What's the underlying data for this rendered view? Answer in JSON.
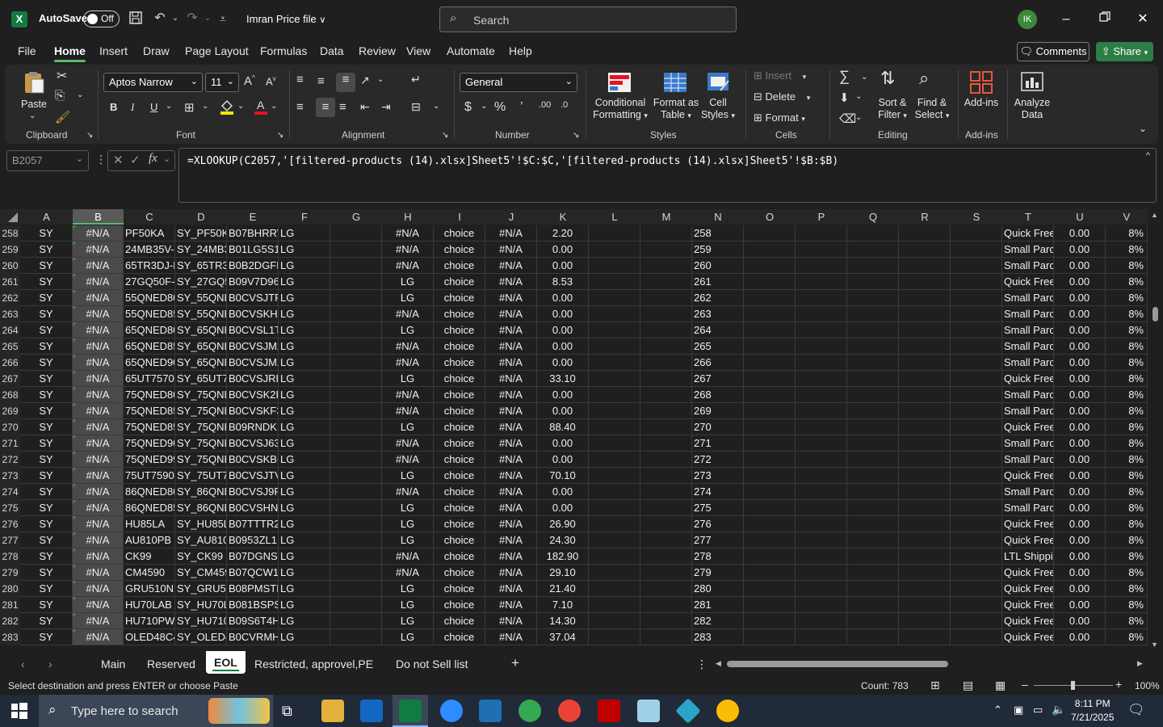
{
  "titlebar": {
    "app_logo": "X",
    "autosave_label": "AutoSave",
    "autosave_state": "Off",
    "file_title": "Imran Price file",
    "search_placeholder": "Search",
    "avatar_initials": "IK"
  },
  "menu": {
    "tabs": [
      "File",
      "Home",
      "Insert",
      "Draw",
      "Page Layout",
      "Formulas",
      "Data",
      "Review",
      "View",
      "Automate",
      "Help"
    ],
    "active_tab": "Home",
    "comments_label": "Comments",
    "share_label": "Share"
  },
  "ribbon": {
    "groups": {
      "clipboard": "Clipboard",
      "font": "Font",
      "alignment": "Alignment",
      "number": "Number",
      "styles": "Styles",
      "cells": "Cells",
      "editing": "Editing",
      "addins": "Add-ins"
    },
    "paste_label": "Paste",
    "font_name": "Aptos Narrow",
    "font_size": "11",
    "number_format": "General",
    "conditional_formatting": [
      "Conditional",
      "Formatting"
    ],
    "format_as_table": [
      "Format as",
      "Table"
    ],
    "cell_styles": [
      "Cell",
      "Styles"
    ],
    "insert_label": "Insert",
    "delete_label": "Delete",
    "format_label": "Format",
    "sort_filter": [
      "Sort &",
      "Filter"
    ],
    "find_select": [
      "Find &",
      "Select"
    ],
    "addins_label": "Add-ins",
    "analyze_data": [
      "Analyze",
      "Data"
    ]
  },
  "formula_bar": {
    "name_box": "B2057",
    "formula": "=XLOOKUP(C2057,'[filtered-products (14).xlsx]Sheet5'!$C:$C,'[filtered-products (14).xlsx]Sheet5'!$B:$B)"
  },
  "grid": {
    "columns": [
      "A",
      "B",
      "C",
      "D",
      "E",
      "F",
      "G",
      "H",
      "I",
      "J",
      "K",
      "L",
      "M",
      "N",
      "O",
      "P",
      "Q",
      "R",
      "S",
      "T",
      "U",
      "V"
    ],
    "selected_column": "B",
    "rows": [
      {
        "n": "258",
        "a": "SY",
        "b": "#N/A",
        "c": "PF50KA",
        "d": "SY_PF50KA",
        "e": "B07BHRRV",
        "f": "LG",
        "h": "#N/A",
        "i": "choice",
        "j": "#N/A",
        "k": "2.20",
        "t": "Quick Free",
        "u": "0.00",
        "v": "8%"
      },
      {
        "n": "259",
        "a": "SY",
        "b": "#N/A",
        "c": "24MB35V-",
        "d": "SY_24MB3",
        "e": "B01LG5S12",
        "f": "LG",
        "h": "#N/A",
        "i": "choice",
        "j": "#N/A",
        "k": "0.00",
        "t": "Small Parc",
        "u": "0.00",
        "v": "8%"
      },
      {
        "n": "260",
        "a": "SY",
        "b": "#N/A",
        "c": "65TR3DJ-E",
        "d": "SY_65TR3D",
        "e": "B0B2DGFE",
        "f": "LG",
        "h": "#N/A",
        "i": "choice",
        "j": "#N/A",
        "k": "0.00",
        "t": "Small Parc",
        "u": "0.00",
        "v": "8%"
      },
      {
        "n": "261",
        "a": "SY",
        "b": "#N/A",
        "c": "27GQ50F-(",
        "d": "SY_27GQ5",
        "e": "B09V7D96",
        "f": "LG",
        "h": "LG",
        "i": "choice",
        "j": "#N/A",
        "k": "8.53",
        "t": "Quick Free",
        "u": "0.00",
        "v": "8%"
      },
      {
        "n": "262",
        "a": "SY",
        "b": "#N/A",
        "c": "55QNED80",
        "d": "SY_55QNE",
        "e": "B0CVSJTPI",
        "f": "LG",
        "h": "LG",
        "i": "choice",
        "j": "#N/A",
        "k": "0.00",
        "t": "Small Parc",
        "u": "0.00",
        "v": "8%"
      },
      {
        "n": "263",
        "a": "SY",
        "b": "#N/A",
        "c": "55QNED85",
        "d": "SY_55QNE",
        "e": "B0CVSKHN",
        "f": "LG",
        "h": "#N/A",
        "i": "choice",
        "j": "#N/A",
        "k": "0.00",
        "t": "Small Parc",
        "u": "0.00",
        "v": "8%"
      },
      {
        "n": "264",
        "a": "SY",
        "b": "#N/A",
        "c": "65QNED80",
        "d": "SY_65QNE",
        "e": "B0CVSL1T.",
        "f": "LG",
        "h": "LG",
        "i": "choice",
        "j": "#N/A",
        "k": "0.00",
        "t": "Small Parc",
        "u": "0.00",
        "v": "8%"
      },
      {
        "n": "265",
        "a": "SY",
        "b": "#N/A",
        "c": "65QNED85",
        "d": "SY_65QNE",
        "e": "B0CVSJMZ",
        "f": "LG",
        "h": "#N/A",
        "i": "choice",
        "j": "#N/A",
        "k": "0.00",
        "t": "Small Parc",
        "u": "0.00",
        "v": "8%"
      },
      {
        "n": "266",
        "a": "SY",
        "b": "#N/A",
        "c": "65QNED90",
        "d": "SY_65QNE",
        "e": "B0CVSJMZ",
        "f": "LG",
        "h": "#N/A",
        "i": "choice",
        "j": "#N/A",
        "k": "0.00",
        "t": "Small Parc",
        "u": "0.00",
        "v": "8%"
      },
      {
        "n": "267",
        "a": "SY",
        "b": "#N/A",
        "c": "65UT7570I",
        "d": "SY_65UT75",
        "e": "B0CVSJRB",
        "f": "LG",
        "h": "LG",
        "i": "choice",
        "j": "#N/A",
        "k": "33.10",
        "t": "Quick Free",
        "u": "0.00",
        "v": "8%"
      },
      {
        "n": "268",
        "a": "SY",
        "b": "#N/A",
        "c": "75QNED80",
        "d": "SY_75QNE",
        "e": "B0CVSK2F",
        "f": "LG",
        "h": "#N/A",
        "i": "choice",
        "j": "#N/A",
        "k": "0.00",
        "t": "Small Parc",
        "u": "0.00",
        "v": "8%"
      },
      {
        "n": "269",
        "a": "SY",
        "b": "#N/A",
        "c": "75QNED85",
        "d": "SY_75QNE",
        "e": "B0CVSKF3",
        "f": "LG",
        "h": "#N/A",
        "i": "choice",
        "j": "#N/A",
        "k": "0.00",
        "t": "Small Parc",
        "u": "0.00",
        "v": "8%"
      },
      {
        "n": "270",
        "a": "SY",
        "b": "#N/A",
        "c": "75QNED85",
        "d": "SY_75QNE",
        "e": "B09RNDKN",
        "f": "LG",
        "h": "LG",
        "i": "choice",
        "j": "#N/A",
        "k": "88.40",
        "t": "Quick Free",
        "u": "0.00",
        "v": "8%"
      },
      {
        "n": "271",
        "a": "SY",
        "b": "#N/A",
        "c": "75QNED90",
        "d": "SY_75QNE",
        "e": "B0CVSJ636",
        "f": "LG",
        "h": "#N/A",
        "i": "choice",
        "j": "#N/A",
        "k": "0.00",
        "t": "Small Parc",
        "u": "0.00",
        "v": "8%"
      },
      {
        "n": "272",
        "a": "SY",
        "b": "#N/A",
        "c": "75QNED99",
        "d": "SY_75QNE",
        "e": "B0CVSKBC",
        "f": "LG",
        "h": "#N/A",
        "i": "choice",
        "j": "#N/A",
        "k": "0.00",
        "t": "Small Parc",
        "u": "0.00",
        "v": "8%"
      },
      {
        "n": "273",
        "a": "SY",
        "b": "#N/A",
        "c": "75UT7590I",
        "d": "SY_75UT75",
        "e": "B0CVSJTV",
        "f": "LG",
        "h": "LG",
        "i": "choice",
        "j": "#N/A",
        "k": "70.10",
        "t": "Quick Free",
        "u": "0.00",
        "v": "8%"
      },
      {
        "n": "274",
        "a": "SY",
        "b": "#N/A",
        "c": "86QNED80",
        "d": "SY_86QNE",
        "e": "B0CVSJ9F",
        "f": "LG",
        "h": "#N/A",
        "i": "choice",
        "j": "#N/A",
        "k": "0.00",
        "t": "Small Parc",
        "u": "0.00",
        "v": "8%"
      },
      {
        "n": "275",
        "a": "SY",
        "b": "#N/A",
        "c": "86QNED85",
        "d": "SY_86QNE",
        "e": "B0CVSHN9",
        "f": "LG",
        "h": "LG",
        "i": "choice",
        "j": "#N/A",
        "k": "0.00",
        "t": "Small Parc",
        "u": "0.00",
        "v": "8%"
      },
      {
        "n": "276",
        "a": "SY",
        "b": "#N/A",
        "c": "HU85LA",
        "d": "SY_HU85L",
        "e": "B07TTTR2",
        "f": "LG",
        "h": "LG",
        "i": "choice",
        "j": "#N/A",
        "k": "26.90",
        "t": "Quick Free",
        "u": "0.00",
        "v": "8%"
      },
      {
        "n": "277",
        "a": "SY",
        "b": "#N/A",
        "c": "AU810PB",
        "d": "SY_AU810I",
        "e": "B0953ZL1N",
        "f": "LG",
        "h": "LG",
        "i": "choice",
        "j": "#N/A",
        "k": "24.30",
        "t": "Quick Free",
        "u": "0.00",
        "v": "8%"
      },
      {
        "n": "278",
        "a": "SY",
        "b": "#N/A",
        "c": "CK99",
        "d": "SY_CK99",
        "e": "B07DGNS\\",
        "f": "LG",
        "h": "#N/A",
        "i": "choice",
        "j": "#N/A",
        "k": "182.90",
        "t": "LTL Shippi",
        "u": "0.00",
        "v": "8%"
      },
      {
        "n": "279",
        "a": "SY",
        "b": "#N/A",
        "c": "CM4590",
        "d": "SY_CM459",
        "e": "B07QCW1.",
        "f": "LG",
        "h": "#N/A",
        "i": "choice",
        "j": "#N/A",
        "k": "29.10",
        "t": "Quick Free",
        "u": "0.00",
        "v": "8%"
      },
      {
        "n": "280",
        "a": "SY",
        "b": "#N/A",
        "c": "GRU510N",
        "d": "SY_GRU51",
        "e": "B08PMSTL",
        "f": "LG",
        "h": "LG",
        "i": "choice",
        "j": "#N/A",
        "k": "21.40",
        "t": "Quick Free",
        "u": "0.00",
        "v": "8%"
      },
      {
        "n": "281",
        "a": "SY",
        "b": "#N/A",
        "c": "HU70LAB",
        "d": "SY_HU70L",
        "e": "B081BSPS",
        "f": "LG",
        "h": "LG",
        "i": "choice",
        "j": "#N/A",
        "k": "7.10",
        "t": "Quick Free",
        "u": "0.00",
        "v": "8%"
      },
      {
        "n": "282",
        "a": "SY",
        "b": "#N/A",
        "c": "HU710PW",
        "d": "SY_HU710",
        "e": "B09S6T4H",
        "f": "LG",
        "h": "LG",
        "i": "choice",
        "j": "#N/A",
        "k": "14.30",
        "t": "Quick Free",
        "u": "0.00",
        "v": "8%"
      },
      {
        "n": "283",
        "a": "SY",
        "b": "#N/A",
        "c": "OLED48C4",
        "d": "SY_OLED4",
        "e": "B0CVRMHI",
        "f": "LG",
        "h": "LG",
        "i": "choice",
        "j": "#N/A",
        "k": "37.04",
        "t": "Quick Free",
        "u": "0.00",
        "v": "8%"
      }
    ]
  },
  "sheets": {
    "tabs": [
      "Main",
      "Reserved",
      "EOL",
      "Restricted, approvel,PE",
      "Do not Sell list"
    ],
    "active": "EOL"
  },
  "status": {
    "message": "Select destination and press ENTER or choose Paste",
    "count": "Count: 783",
    "zoom": "100%"
  },
  "taskbar": {
    "search_placeholder": "Type here to search",
    "time": "8:11 PM",
    "date": "7/21/2025"
  }
}
